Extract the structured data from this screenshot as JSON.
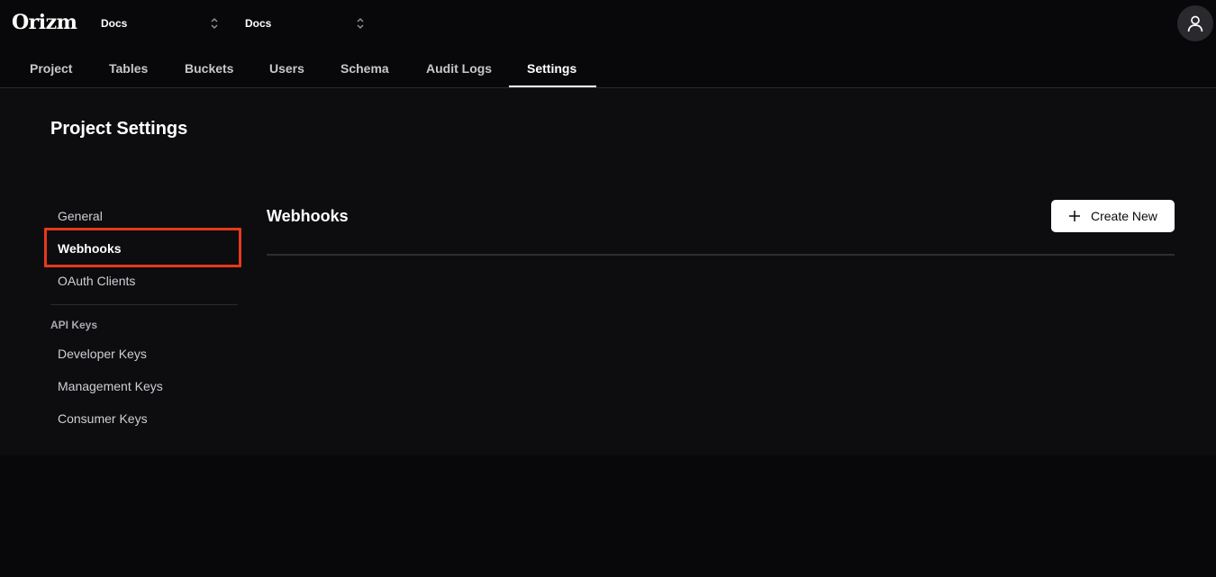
{
  "header": {
    "logo": "Orizm",
    "selector1": "Docs",
    "selector2": "Docs",
    "avatar_icon": "user-icon"
  },
  "tabs": [
    {
      "label": "Project"
    },
    {
      "label": "Tables"
    },
    {
      "label": "Buckets"
    },
    {
      "label": "Users"
    },
    {
      "label": "Schema"
    },
    {
      "label": "Audit Logs"
    },
    {
      "label": "Settings",
      "active": true
    }
  ],
  "page": {
    "title": "Project Settings"
  },
  "sidebar": {
    "items": [
      {
        "label": "General"
      },
      {
        "label": "Webhooks",
        "active": true
      },
      {
        "label": "OAuth Clients"
      }
    ],
    "section_label": "API Keys",
    "key_items": [
      {
        "label": "Developer Keys"
      },
      {
        "label": "Management Keys"
      },
      {
        "label": "Consumer Keys"
      }
    ]
  },
  "main": {
    "title": "Webhooks",
    "create_label": "Create New"
  },
  "colors": {
    "highlight": "#e8381c",
    "background": "#08080a",
    "panel": "#0d0d10"
  }
}
